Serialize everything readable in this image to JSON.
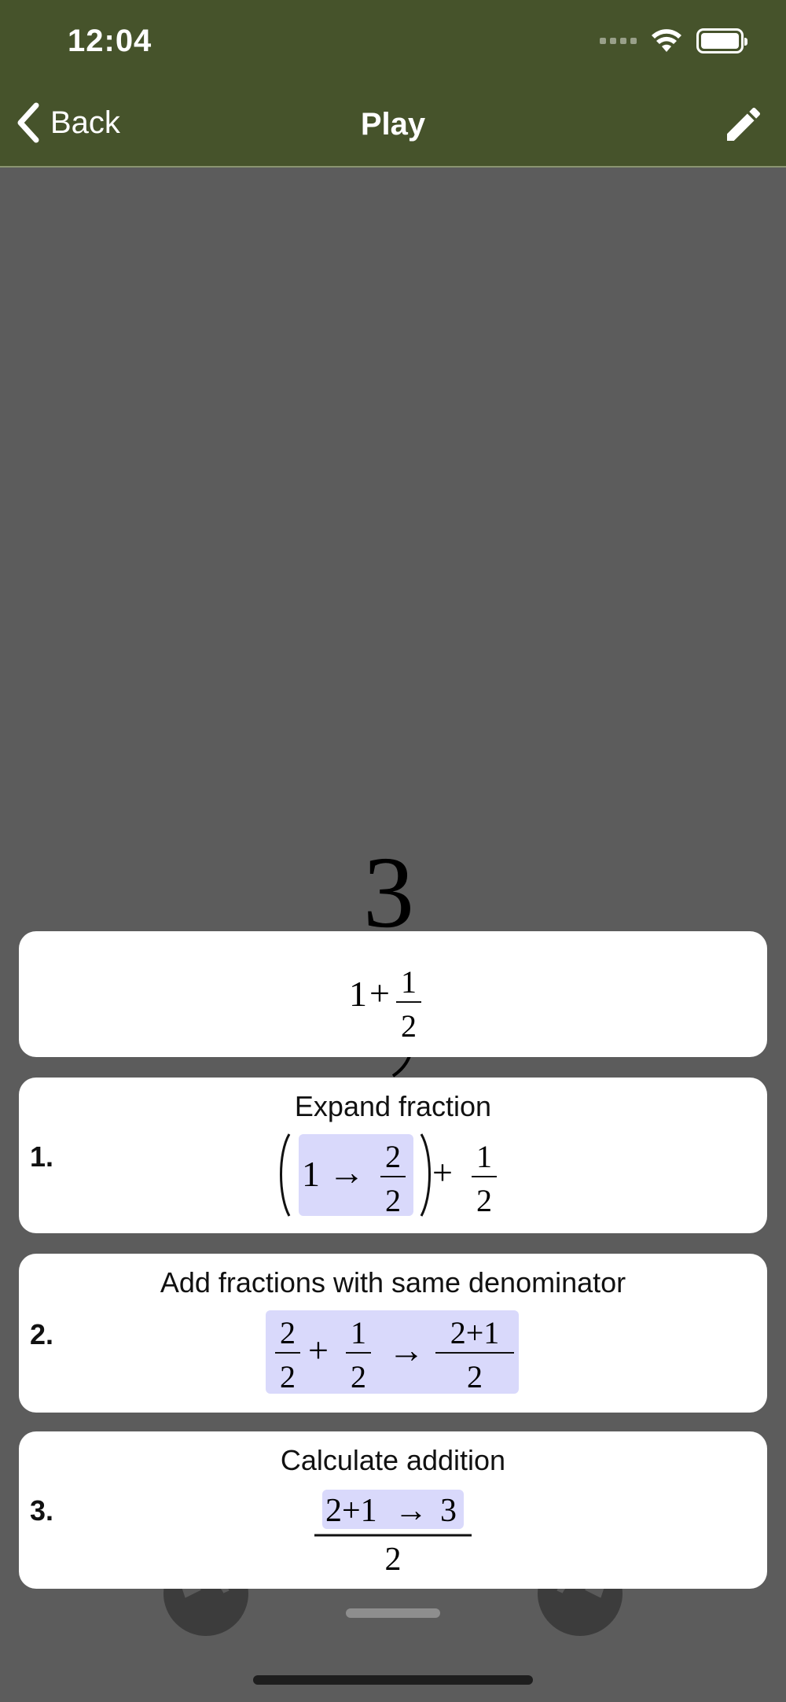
{
  "status": {
    "time": "12:04"
  },
  "nav": {
    "back_label": "Back",
    "title": "Play"
  },
  "background_expression": {
    "visible_digit": "3"
  },
  "cards": {
    "current": {
      "whole": "1",
      "plus": "+",
      "num": "1",
      "den": "2"
    },
    "step1": {
      "number": "1.",
      "title": "Expand fraction",
      "whole": "1",
      "arrow": "→",
      "exp_num": "2",
      "exp_den": "2",
      "plus": "+",
      "num": "1",
      "den": "2"
    },
    "step2": {
      "number": "2.",
      "title": "Add fractions with same denominator",
      "a_num": "2",
      "a_den": "2",
      "plus": "+",
      "b_num": "1",
      "b_den": "2",
      "arrow": "→",
      "r_num": "2+1",
      "r_den": "2"
    },
    "step3": {
      "number": "3.",
      "title": "Calculate addition",
      "top": "2+1",
      "arrow": "→",
      "result": "3",
      "den": "2"
    }
  },
  "icons": {
    "back": "chevron-left-icon",
    "edit": "pencil-icon",
    "undo": "undo-icon",
    "redo": "redo-icon"
  },
  "colors": {
    "header_bg": "#46532b",
    "page_bg": "#5c5c5c",
    "highlight": "#d9d9fb"
  }
}
